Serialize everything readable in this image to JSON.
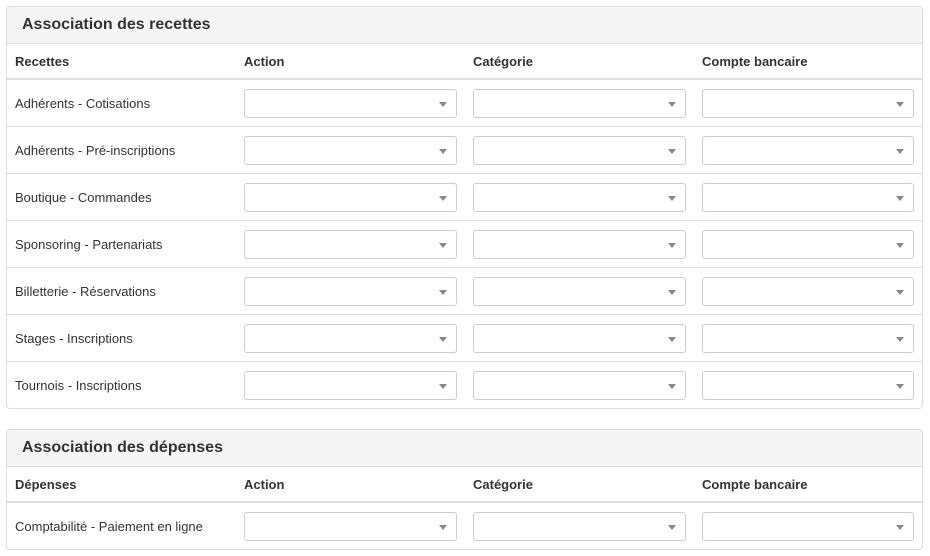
{
  "recettes": {
    "title": "Association des recettes",
    "columns": [
      "Recettes",
      "Action",
      "Catégorie",
      "Compte bancaire"
    ],
    "rows": [
      {
        "label": "Adhérents - Cotisations",
        "action": "",
        "categorie": "",
        "compte": ""
      },
      {
        "label": "Adhérents - Pré-inscriptions",
        "action": "",
        "categorie": "",
        "compte": ""
      },
      {
        "label": "Boutique - Commandes",
        "action": "",
        "categorie": "",
        "compte": ""
      },
      {
        "label": "Sponsoring - Partenariats",
        "action": "",
        "categorie": "",
        "compte": ""
      },
      {
        "label": "Billetterie - Réservations",
        "action": "",
        "categorie": "",
        "compte": ""
      },
      {
        "label": "Stages - Inscriptions",
        "action": "",
        "categorie": "",
        "compte": ""
      },
      {
        "label": "Tournois - Inscriptions",
        "action": "",
        "categorie": "",
        "compte": ""
      }
    ]
  },
  "depenses": {
    "title": "Association des dépenses",
    "columns": [
      "Dépenses",
      "Action",
      "Catégorie",
      "Compte bancaire"
    ],
    "rows": [
      {
        "label": "Comptabilité - Paiement en ligne",
        "action": "",
        "categorie": "",
        "compte": ""
      }
    ]
  },
  "icons": {
    "select_arrow": "chevron-down-icon"
  },
  "colors": {
    "panel_heading_bg": "#f5f5f5",
    "border": "#dddddd",
    "select_border": "#cccccc",
    "text": "#333333"
  }
}
